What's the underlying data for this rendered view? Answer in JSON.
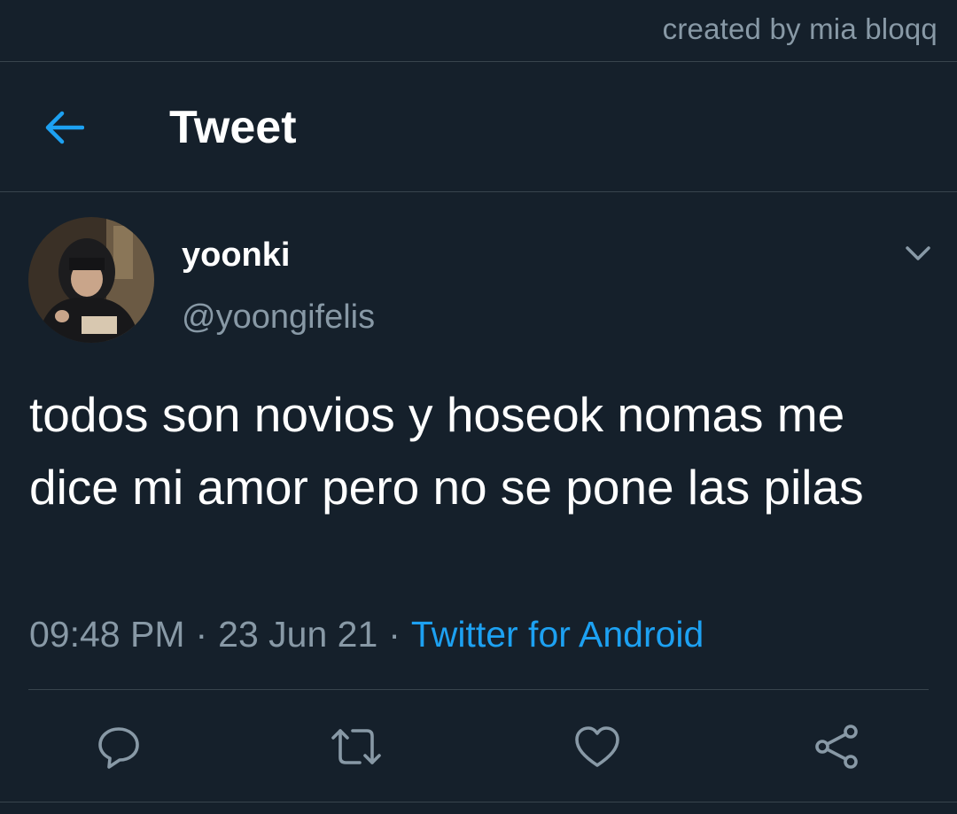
{
  "watermark": "created by mia bloqq",
  "header": {
    "back_icon": "arrow-left-icon",
    "title": "Tweet"
  },
  "tweet": {
    "author": {
      "display_name": "yoonki",
      "handle": "@yoongifelis"
    },
    "text": "todos son novios y hoseok nomas me dice mi amor pero no se pone las pilas",
    "time": "09:48 PM",
    "date": "23 Jun 21",
    "separator": "·",
    "source": "Twitter for Android"
  },
  "actions": [
    {
      "name": "reply",
      "icon": "reply-icon"
    },
    {
      "name": "retweet",
      "icon": "retweet-icon"
    },
    {
      "name": "like",
      "icon": "heart-icon"
    },
    {
      "name": "share",
      "icon": "share-icon"
    }
  ],
  "colors": {
    "background": "#15202b",
    "accent": "#1da1f2",
    "secondary_text": "#8899a6",
    "divider": "#38444d"
  }
}
